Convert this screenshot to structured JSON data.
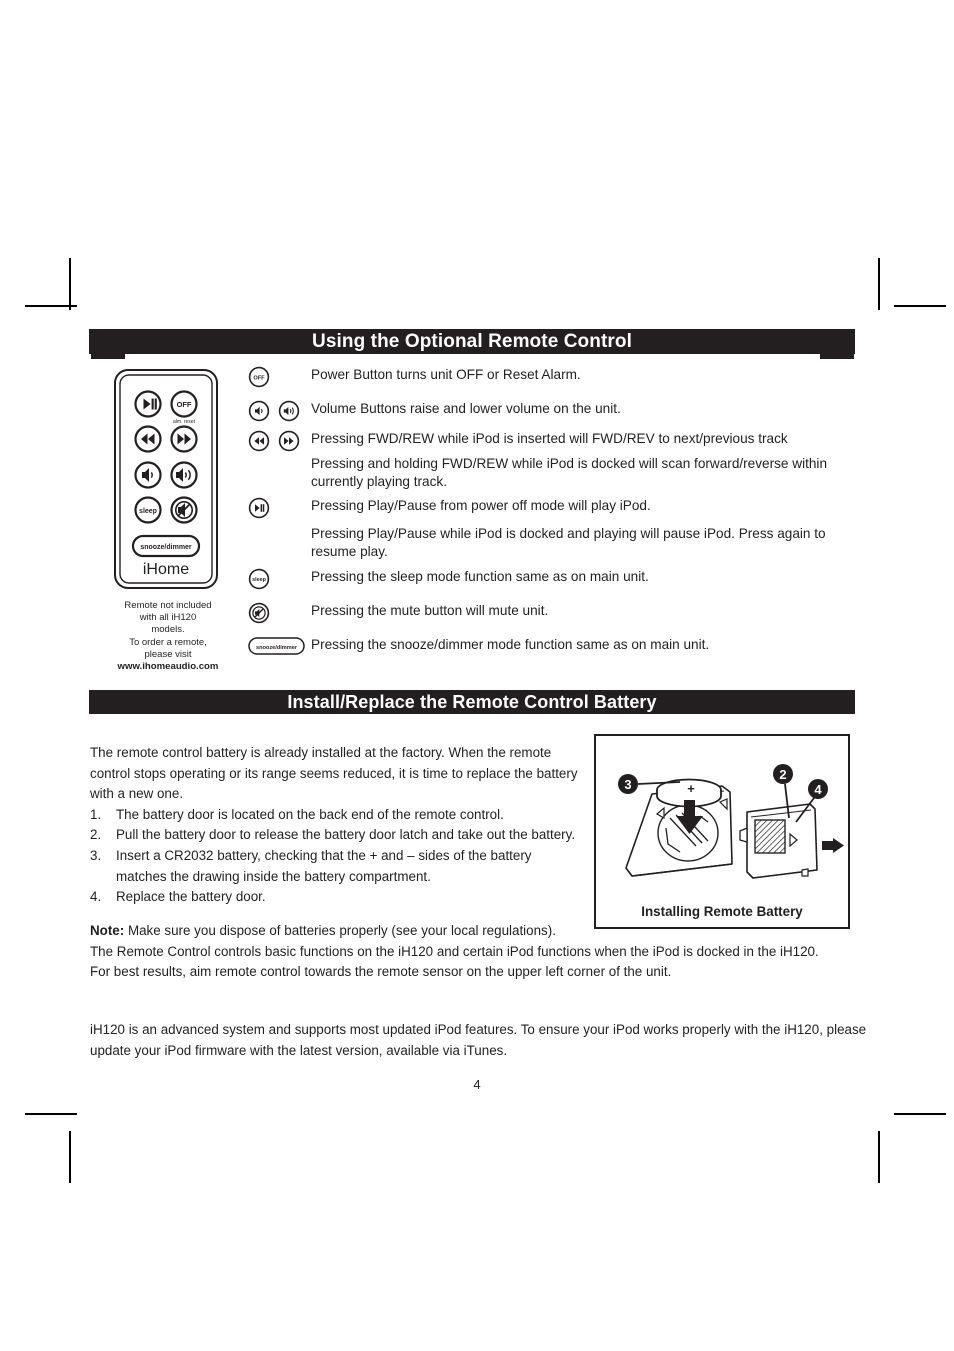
{
  "page": {
    "number": "4"
  },
  "sections": {
    "remote": {
      "header": "Using the Optional Remote Control",
      "figure": {
        "brand": "iHome",
        "buttons": {
          "play_pause": "play-pause",
          "off": "OFF",
          "off_sub": "alm. reset",
          "rew": "rewind",
          "fwd": "forward",
          "vol_down": "volume-down",
          "vol_up": "volume-up",
          "sleep": "sleep",
          "mute": "mute",
          "snooze_dimmer": "snooze/dimmer"
        }
      },
      "caption": {
        "line1": "Remote not included",
        "line2": "with all iH120",
        "line3": "models.",
        "line4": "To order a remote,",
        "line5": "please visit",
        "url": "www.ihomeaudio.com"
      },
      "rows": [
        {
          "icons": [
            "off"
          ],
          "text": "Power Button turns unit OFF or Reset Alarm."
        },
        {
          "icons": [
            "vol-down",
            "vol-up"
          ],
          "text": "Volume Buttons raise and lower volume on the unit."
        },
        {
          "icons": [
            "rew",
            "fwd"
          ],
          "text": "Pressing FWD/REW while iPod is inserted will FWD/REV to next/previous track"
        },
        {
          "icons": [],
          "text": "Pressing and holding FWD/REW while iPod is docked will scan forward/reverse within currently playing track."
        },
        {
          "icons": [
            "play-pause"
          ],
          "text": "Pressing Play/Pause from power off mode will play iPod."
        },
        {
          "icons": [],
          "text": "Pressing Play/Pause while iPod is docked and playing will pause iPod. Press again to resume play."
        },
        {
          "icons": [
            "sleep"
          ],
          "text": "Pressing the sleep mode function same as on main unit."
        },
        {
          "icons": [
            "mute"
          ],
          "text": "Pressing the mute button will mute unit."
        },
        {
          "icons": [
            "snooze-dimmer"
          ],
          "text": "Pressing the snooze/dimmer mode function same as on main unit."
        }
      ]
    },
    "battery": {
      "header": "Install/Replace the Remote Control Battery",
      "intro": "The remote control battery is already installed at the factory. When the remote control stops operating or its range seems reduced, it is time to replace the battery with a new one.",
      "steps": [
        {
          "num": "1.",
          "text": "The battery door is located on the back end of the remote control."
        },
        {
          "num": "2.",
          "text": " Pull the battery door to release the battery door latch and take out the battery."
        },
        {
          "num": "3.",
          "text": "Insert a CR2032 battery, checking that the + and – sides of the battery matches the drawing inside the battery compartment."
        },
        {
          "num": "4.",
          "text": "Replace the battery door."
        }
      ],
      "note_label": "Note:",
      "note_text": " Make sure you dispose of batteries properly (see your local regulations).",
      "paragraph1": "The Remote Control controls basic functions on the iH120 and certain iPod functions when the iPod is docked in the iH120.",
      "paragraph2": "For best results, aim remote control towards the remote sensor on the upper left corner of the unit.",
      "diagram": {
        "caption": "Installing Remote Battery",
        "callouts": [
          "3",
          "2",
          "4"
        ],
        "battery_polarity": "+"
      }
    },
    "footer": {
      "paragraph": "iH120 is an advanced system and supports most updated iPod features. To ensure your iPod works properly with the iH120, please update your iPod firmware with the latest version, available via iTunes."
    }
  },
  "colors": {
    "ink": "#231f20",
    "paper": "#ffffff"
  }
}
